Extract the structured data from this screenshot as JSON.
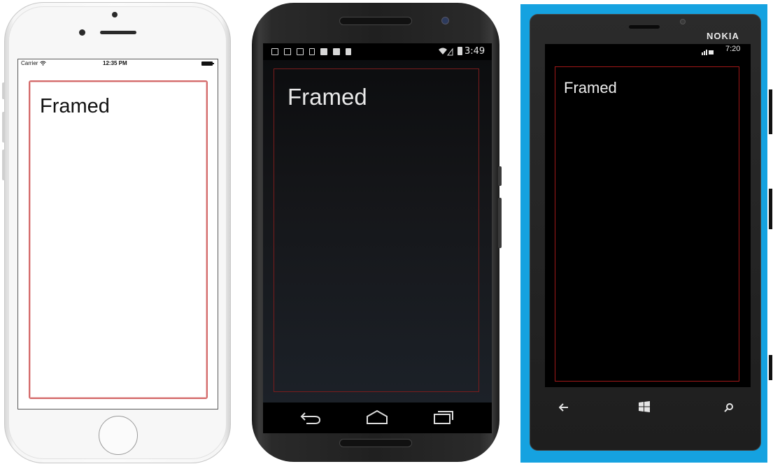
{
  "devices": {
    "ios": {
      "carrier": "Carrier",
      "wifi_icon": "wifi-icon",
      "time": "12:35 PM",
      "battery_icon": "battery-icon",
      "framed_label": "Framed",
      "frame_color": "#d46a6a"
    },
    "android": {
      "time": "3:49",
      "status_icons": [
        "notification-icon",
        "image-icon",
        "gmail-icon",
        "download-icon",
        "store-icon",
        "store-icon",
        "sd-card-icon"
      ],
      "framed_label": "Framed",
      "frame_color": "#7a1c1c",
      "nav": {
        "back_icon": "back-icon",
        "home_icon": "home-icon",
        "recents_icon": "recents-icon"
      }
    },
    "nokia": {
      "brand": "NOKIA",
      "time": "7:20",
      "framed_label": "Framed",
      "frame_color": "#a11818",
      "nav": {
        "back_icon": "back-arrow-icon",
        "start_icon": "windows-logo-icon",
        "search_icon": "search-icon"
      }
    }
  }
}
